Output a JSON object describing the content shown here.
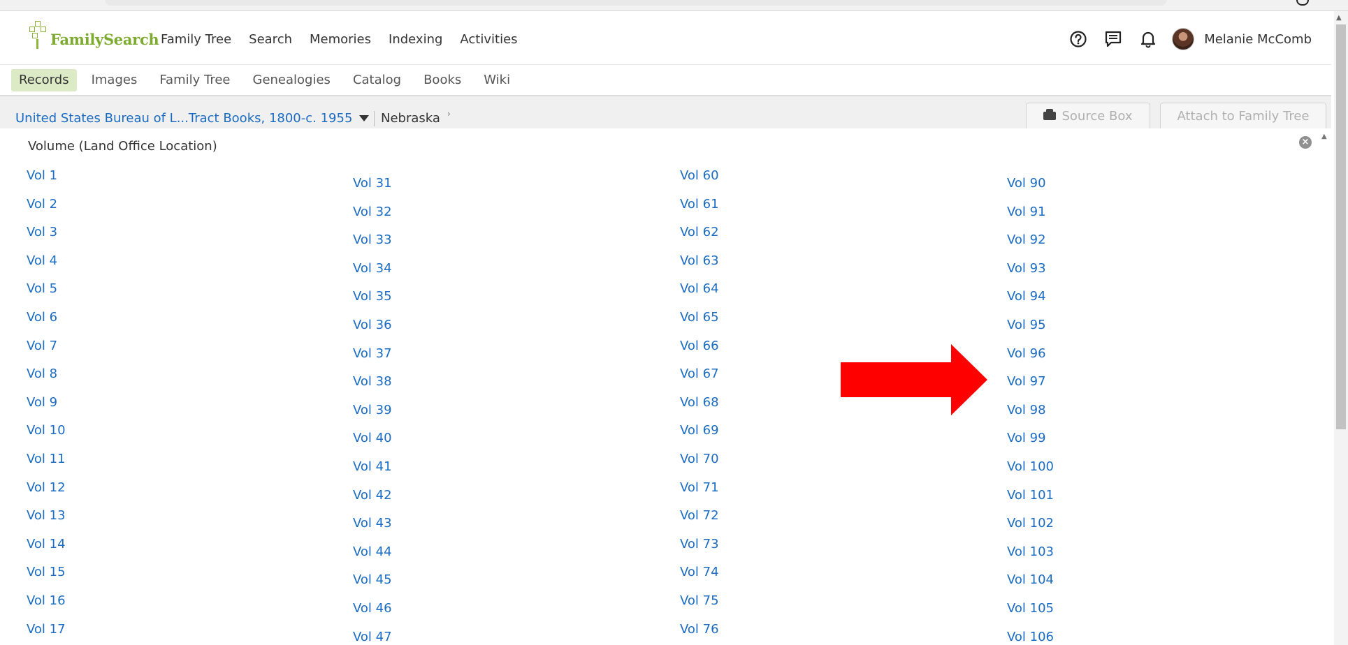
{
  "header": {
    "logo_text": "FamilySearch",
    "nav": [
      "Family Tree",
      "Search",
      "Memories",
      "Indexing",
      "Activities"
    ],
    "user_name": "Melanie McComb",
    "icons": [
      "help-icon",
      "messages-icon",
      "notifications-icon"
    ]
  },
  "subnav": {
    "items": [
      "Records",
      "Images",
      "Family Tree",
      "Genealogies",
      "Catalog",
      "Books",
      "Wiki"
    ],
    "active": "Records"
  },
  "breadcrumb": {
    "collection": "United States Bureau of L...Tract Books, 1800-c. 1955",
    "current": "Nebraska"
  },
  "actions": {
    "source_box": "Source Box",
    "attach": "Attach to Family Tree"
  },
  "panel": {
    "title": "Volume (Land Office Location)",
    "columns": [
      [
        "Vol 1",
        "Vol 2",
        "Vol 3",
        "Vol 4",
        "Vol 5",
        "Vol 6",
        "Vol 7",
        "Vol 8",
        "Vol 9",
        "Vol 10",
        "Vol 11",
        "Vol 12",
        "Vol 13",
        "Vol 14",
        "Vol 15",
        "Vol 16",
        "Vol 17"
      ],
      [
        "Vol 31",
        "Vol 32",
        "Vol 33",
        "Vol 34",
        "Vol 35",
        "Vol 36",
        "Vol 37",
        "Vol 38",
        "Vol 39",
        "Vol 40",
        "Vol 41",
        "Vol 42",
        "Vol 43",
        "Vol 44",
        "Vol 45",
        "Vol 46",
        "Vol 47"
      ],
      [
        "Vol 60",
        "Vol 61",
        "Vol 62",
        "Vol 63",
        "Vol 64",
        "Vol 65",
        "Vol 66",
        "Vol 67",
        "Vol 68",
        "Vol 69",
        "Vol 70",
        "Vol 71",
        "Vol 72",
        "Vol 73",
        "Vol 74",
        "Vol 75",
        "Vol 76"
      ],
      [
        "Vol 90",
        "Vol 91",
        "Vol 92",
        "Vol 93",
        "Vol 94",
        "Vol 95",
        "Vol 96",
        "Vol 97",
        "Vol 98",
        "Vol 99",
        "Vol 100",
        "Vol 101",
        "Vol 102",
        "Vol 103",
        "Vol 104",
        "Vol 105",
        "Vol 106"
      ]
    ]
  },
  "annotation": {
    "color": "#ff0000",
    "points_to": "Vol 97"
  },
  "colors": {
    "link": "#1a6bc2",
    "brand_green": "#7dab2f",
    "active_tab_bg": "#dcebc6"
  }
}
